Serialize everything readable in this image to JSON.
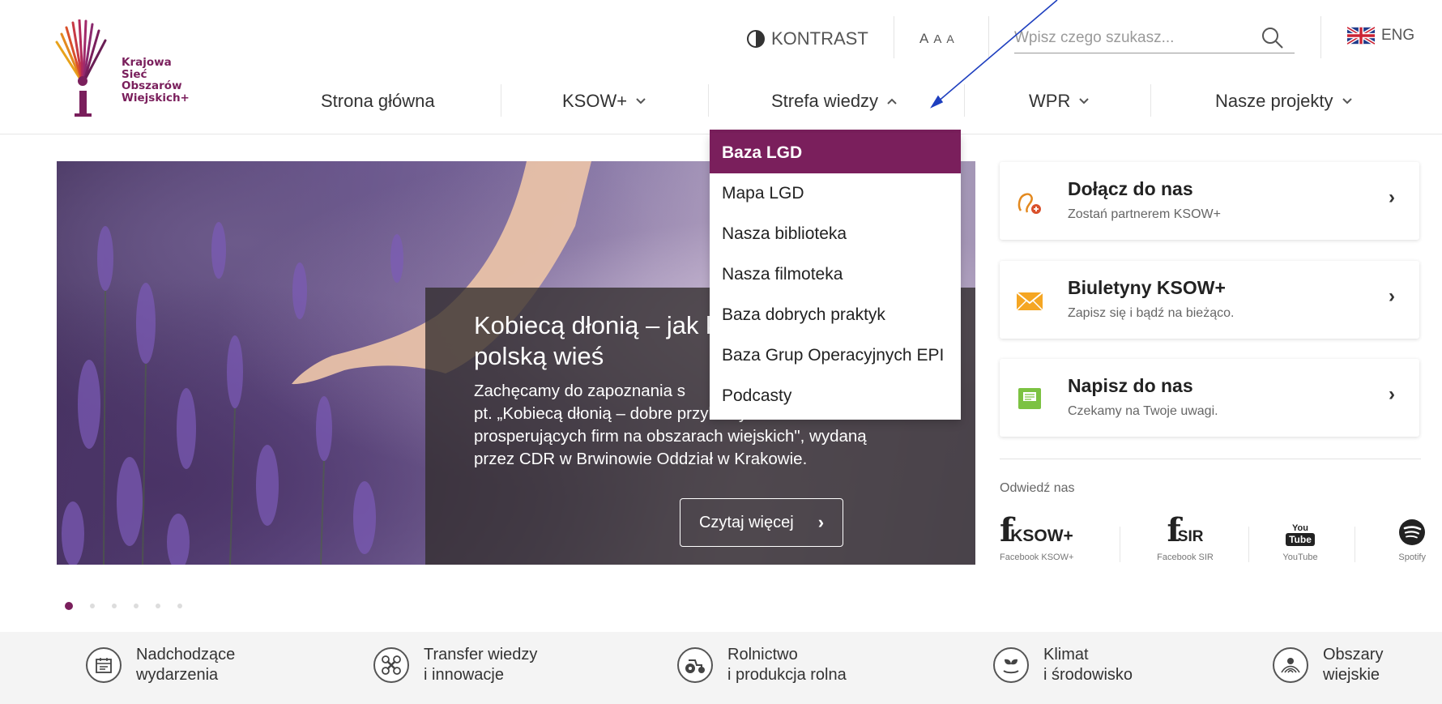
{
  "colors": {
    "accent": "#7a1f5c",
    "annotation": "#1e3fbf"
  },
  "logo": {
    "line1": "Krajowa",
    "line2": "Sieć",
    "line3": "Obszarów",
    "line4": "Wiejskich+"
  },
  "utility": {
    "contrast": "KONTRAST",
    "font_sizes": [
      "A",
      "A",
      "A"
    ],
    "search_placeholder": "Wpisz czego szukasz...",
    "lang": "ENG"
  },
  "nav": {
    "items": [
      {
        "label": "Strona główna",
        "has_chevron": false
      },
      {
        "label": "KSOW+",
        "has_chevron": true
      },
      {
        "label": "Strefa wiedzy",
        "has_chevron": true,
        "expanded": true
      },
      {
        "label": "WPR",
        "has_chevron": true
      },
      {
        "label": "Nasze projekty",
        "has_chevron": true
      }
    ]
  },
  "dropdown": {
    "items": [
      "Baza LGD",
      "Mapa LGD",
      "Nasza biblioteka",
      "Nasza filmoteka",
      "Baza dobrych praktyk",
      "Baza Grup Operacyjnych EPI",
      "Podcasty"
    ],
    "active_index": 0
  },
  "hero": {
    "title": "Kobiecą dłonią – jak ko... polską wieś",
    "title_line1": "Kobiecą dłonią – jak ko",
    "title_line2": "polską wieś",
    "text_line1": "Zachęcamy do zapoznania s",
    "text_line2": "pt. „Kobiecą dłonią – dobre przykłady świetnie",
    "text_line3": "prosperujących firm na obszarach wiejskich\", wydaną",
    "text_line4": "przez CDR w Brwinowie Oddział w Krakowie.",
    "button": "Czytaj więcej",
    "slides": 6,
    "active_slide": 1
  },
  "cards": [
    {
      "title": "Dołącz do nas",
      "subtitle": "Zostań partnerem KSOW+",
      "icon": "partner-icon"
    },
    {
      "title": "Biuletyny KSOW+",
      "subtitle": "Zapisz się i bądź na bieżąco.",
      "icon": "mail-icon"
    },
    {
      "title": "Napisz do nas",
      "subtitle": "Czekamy na Twoje uwagi.",
      "icon": "message-icon"
    }
  ],
  "visit": "Odwiedź nas",
  "social": [
    {
      "brand": "KSOW+",
      "label": "Facebook KSOW+"
    },
    {
      "brand": "SIR",
      "label": "Facebook SIR"
    },
    {
      "brand_top": "You",
      "brand_bottom": "Tube",
      "label": "YouTube"
    },
    {
      "label": "Spotify"
    }
  ],
  "categories": [
    {
      "line1": "Nadchodzące",
      "line2": "wydarzenia",
      "icon": "calendar-icon"
    },
    {
      "line1": "Transfer wiedzy",
      "line2": "i innowacje",
      "icon": "drone-icon"
    },
    {
      "line1": "Rolnictwo",
      "line2": "i produkcja rolna",
      "icon": "tractor-icon"
    },
    {
      "line1": "Klimat",
      "line2": "i środowisko",
      "icon": "leaf-icon"
    },
    {
      "line1": "Obszary",
      "line2": "wiejskie",
      "icon": "field-icon"
    }
  ]
}
